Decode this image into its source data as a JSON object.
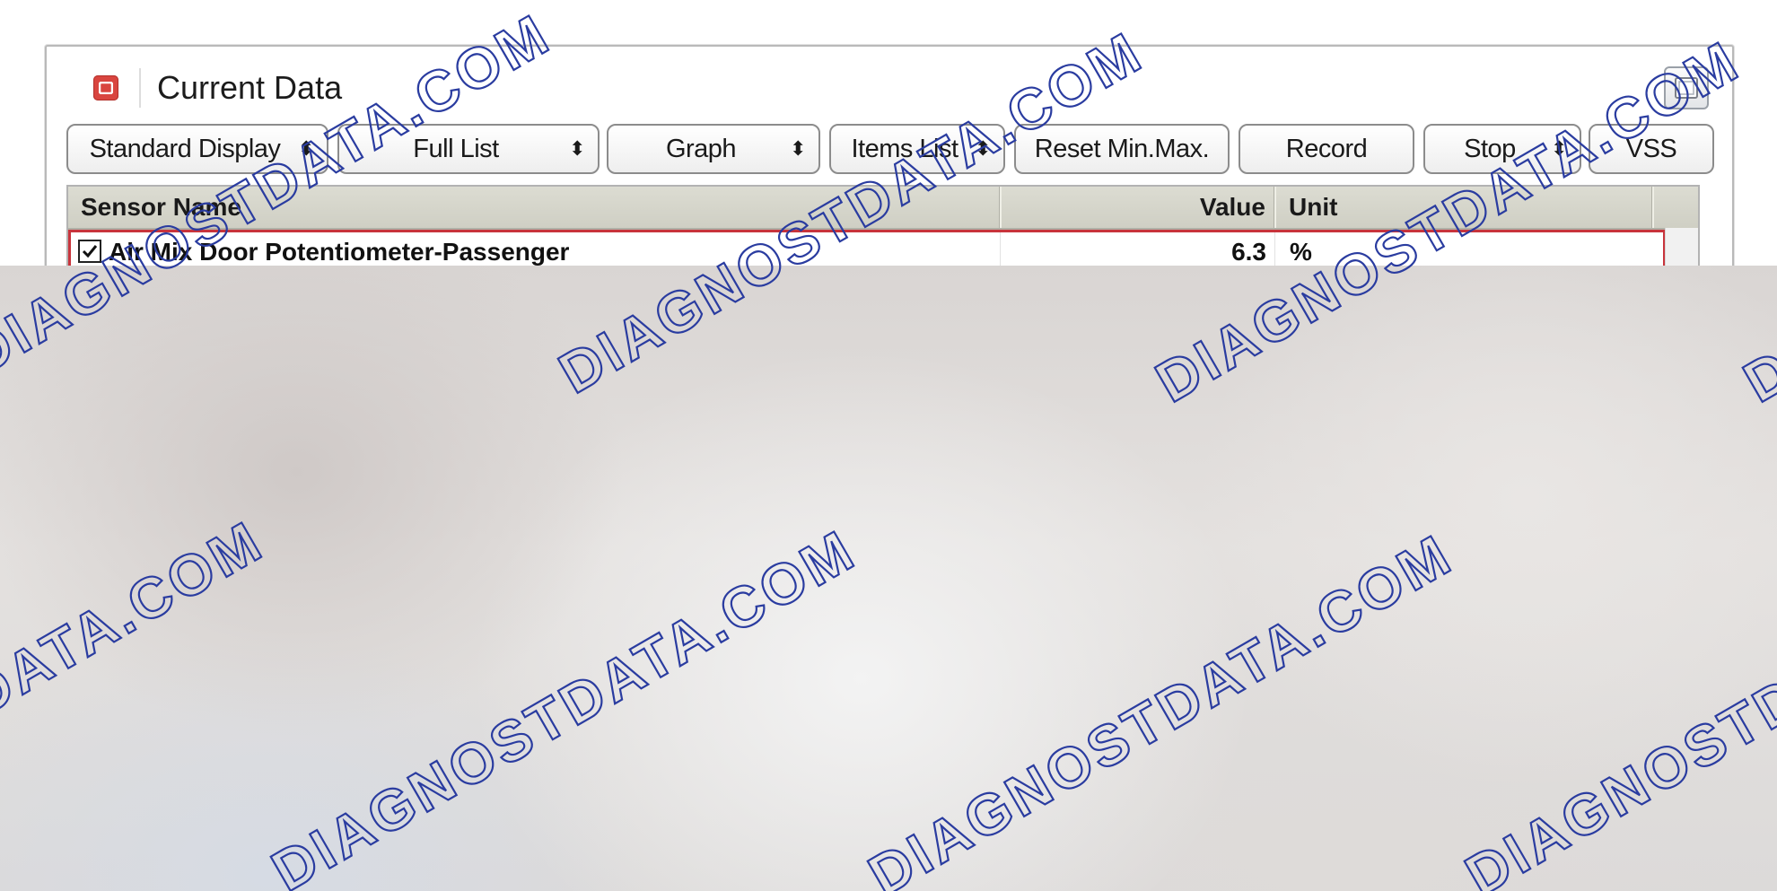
{
  "window": {
    "title": "Current Data"
  },
  "toolbar": {
    "buttons": [
      {
        "label": "Standard Display",
        "has_spinner": true
      },
      {
        "label": "Full List",
        "has_spinner": true
      },
      {
        "label": "Graph",
        "has_spinner": true
      },
      {
        "label": "Items List",
        "has_spinner": true
      },
      {
        "label": "Reset Min.Max.",
        "has_spinner": false
      },
      {
        "label": "Record",
        "has_spinner": false
      },
      {
        "label": "Stop",
        "has_spinner": true
      },
      {
        "label": "VSS",
        "has_spinner": false
      }
    ],
    "spinner_glyph": "⬍"
  },
  "table": {
    "headers": {
      "sensor_name": "Sensor Name",
      "value": "Value",
      "unit": "Unit"
    },
    "rows": [
      {
        "checked": true,
        "sensor_name": "Air Mix Door Potentiometer-Passenger",
        "value": "6.3",
        "unit": "%"
      }
    ]
  },
  "watermark": {
    "top_text": "DIAGNOSTDATA.COM",
    "bottom_text": "DIAGNOSTDATA.COM",
    "color": "#2a3ca0"
  },
  "colors": {
    "close_button": "#d9453f",
    "selected_row_border": "#c8343c",
    "header_background": "#d4d4c9"
  },
  "icons": {
    "close": "close-icon",
    "restore": "restore-window-icon",
    "checkbox": "checkbox-checked-icon"
  }
}
